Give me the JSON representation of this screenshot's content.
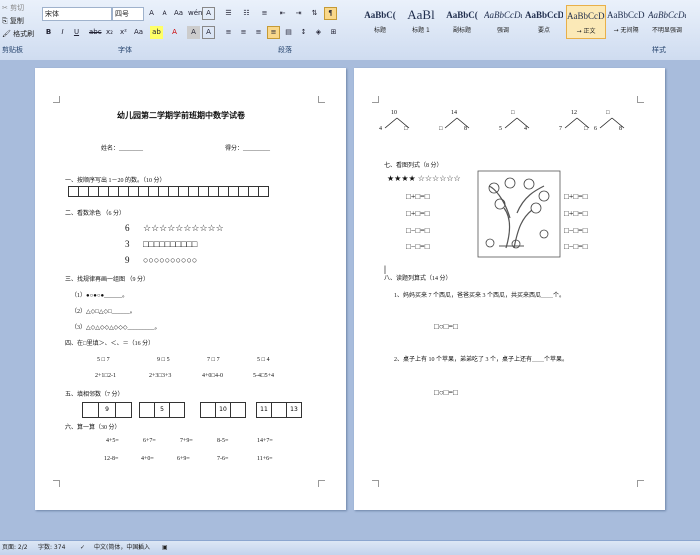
{
  "ribbon": {
    "clipboard": {
      "cut": "剪切",
      "copy": "复制",
      "format_painter": "格式刷",
      "group": "剪贴板"
    },
    "font": {
      "name": "宋体",
      "size": "四号",
      "group": "字体",
      "bold": "B",
      "italic": "I",
      "underline": "U",
      "strike": "abc",
      "sub": "x₂",
      "sup": "x²",
      "aa": "Aa",
      "grow": "A",
      "shrink": "A",
      "clear": "A",
      "phonetic": "wén",
      "charbox": "A"
    },
    "paragraph": {
      "group": "段落"
    },
    "styles": {
      "group": "样式",
      "items": [
        {
          "preview": "AaBbC(",
          "name": "标题"
        },
        {
          "preview": "AaBl",
          "name": "标题 1"
        },
        {
          "preview": "AaBbC(",
          "name": "副标题"
        },
        {
          "preview": "AaBbCcDa",
          "name": "强调"
        },
        {
          "preview": "AaBbCcD",
          "name": "要点"
        },
        {
          "preview": "AaBbCcDc",
          "name": "→ 正文"
        },
        {
          "preview": "AaBbCcDc",
          "name": "→ 无间隔"
        },
        {
          "preview": "AaBbCcDc",
          "name": "不明显强调"
        },
        {
          "preview": "A",
          "name": "明"
        }
      ]
    }
  },
  "page1": {
    "title": "幼儿园第二学期学前班期中数学试卷",
    "name_label": "姓名：________",
    "score_label": "得分：_________",
    "s1": "一、按顺序写出 1－20 的数。（10 分）",
    "s2": "二、看数涂色 （6 分）",
    "s2_rows": [
      {
        "num": "6",
        "shapes": "☆☆☆☆☆☆☆☆☆☆"
      },
      {
        "num": "3",
        "shapes": "□□□□□□□□□□"
      },
      {
        "num": "9",
        "shapes": "○○○○○○○○○○"
      }
    ],
    "s3": "三、找规律再画一组图 （9 分）",
    "s3_rows": [
      "（1）●○●○●______。",
      "（2）△◇□△◇□______。",
      "（3）△◇△◇◇△◇◇◇_________。"
    ],
    "s4": "四、在□里填＞、＜、＝（16 分）",
    "s4_row1": [
      "5 □ 7",
      "9 □ 5",
      "7 □ 7",
      "5 □ 4"
    ],
    "s4_row2": [
      "2+1□2-1",
      "2+3□3+3",
      "4+0□4-0",
      "5-4□5+4"
    ],
    "s5": "五、填相邻数（7 分）",
    "s5_boxes": [
      "9",
      "5",
      "10",
      "11",
      "13"
    ],
    "s6": "六、算一算（30 分）",
    "s6_row1": [
      "4+5=",
      "6+7=",
      "7+9=",
      "8-5=",
      "14+7="
    ],
    "s6_row2": [
      "12-8=",
      "4+0=",
      "6+9=",
      "7-6=",
      "11+6="
    ]
  },
  "page2": {
    "trees": [
      {
        "top": "10",
        "l": "4",
        "r": "□"
      },
      {
        "top": "14",
        "l": "□",
        "r": "8"
      },
      {
        "top": "□",
        "l": "5",
        "r": "4"
      },
      {
        "top": "12",
        "l": "7",
        "r": "□"
      },
      {
        "top": "□",
        "l": "6",
        "r": "8"
      }
    ],
    "s7": "七、看图列式（8 分）",
    "stars_row": "★★★★ ☆☆☆☆☆☆",
    "eq_plus": "□+□=□",
    "eq_minus": "□−□=□",
    "s8": "八、读题列算式（14 分）",
    "q1": "1、妈妈买来 7 个西瓜，爸爸买来 3 个西瓜，共买来西瓜＿＿个。",
    "q1_form": "□○□=□",
    "q2": "2、桌子上有 10 个苹果，弟弟吃了 3 个，桌子上还有＿＿个苹果。",
    "q2_form": "□○□=□"
  },
  "status": {
    "page": "页面: 2/2",
    "words": "字数: 374",
    "lang": "中文(简体，中国)",
    "mode": "插入"
  }
}
